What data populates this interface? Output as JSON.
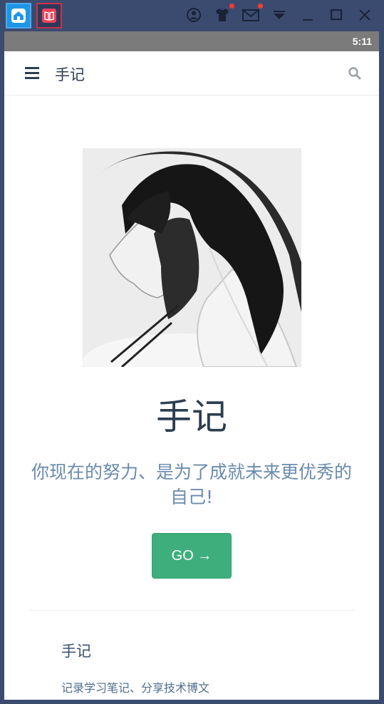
{
  "emulator": {
    "tabs": [
      {
        "icon": "home-icon"
      },
      {
        "icon": "book-app-icon"
      }
    ],
    "controls": [
      {
        "icon": "account-icon"
      },
      {
        "icon": "shirt-icon",
        "badge": true
      },
      {
        "icon": "mail-icon",
        "badge": true
      },
      {
        "icon": "dropdown-arrow-icon"
      },
      {
        "icon": "minimize-icon"
      },
      {
        "icon": "maximize-icon"
      },
      {
        "icon": "close-icon"
      }
    ]
  },
  "status_bar": {
    "time": "5:11"
  },
  "header": {
    "menu_icon": "hamburger-menu-icon",
    "title": "手记",
    "search_icon": "search-icon"
  },
  "hero": {
    "image": "anime-portrait-illustration",
    "title": "手记",
    "description": "你现在的努力、是为了成就未来更优秀的自己!",
    "action_label": "GO →"
  },
  "feature": {
    "title": "手记",
    "description": "记录学习笔记、分享技术博文"
  },
  "colors": {
    "accent": "#3eaf7c",
    "text": "#2c3e50",
    "description": "#6a8bad",
    "emulator_frame": "#3b4b70",
    "status_bar": "#7b7b7b"
  }
}
